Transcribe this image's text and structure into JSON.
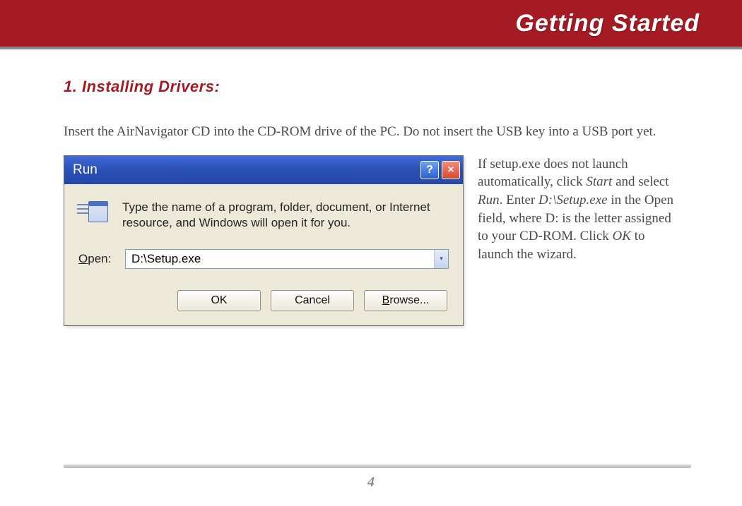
{
  "header": {
    "title": "Getting Started"
  },
  "section": {
    "heading": "1. Installing Drivers:"
  },
  "intro": "Insert the AirNavigator CD into the CD-ROM drive of the PC.  Do not insert the USB key into a USB port yet.",
  "side": {
    "p1": "If setup.exe does not launch automatically, click ",
    "em1": "Start",
    "p2": " and select ",
    "em2": "Run",
    "p3": ".  Enter ",
    "em3": "D:\\Setup.exe",
    "p4": " in the Open field, where  D: is the letter assigned to your CD-ROM.  Click ",
    "em4": "OK",
    "p5": " to launch the wizard."
  },
  "dialog": {
    "title": "Run",
    "help": "?",
    "close": "×",
    "prompt": "Type the name of a program, folder, document, or Internet resource, and Windows will open it for you.",
    "open_label_pre": "O",
    "open_label_post": "pen:",
    "open_value": "D:\\Setup.exe",
    "dropdown_glyph": "▾",
    "ok": "OK",
    "cancel": "Cancel",
    "browse_pre": "B",
    "browse_post": "rowse..."
  },
  "page_number": "4"
}
